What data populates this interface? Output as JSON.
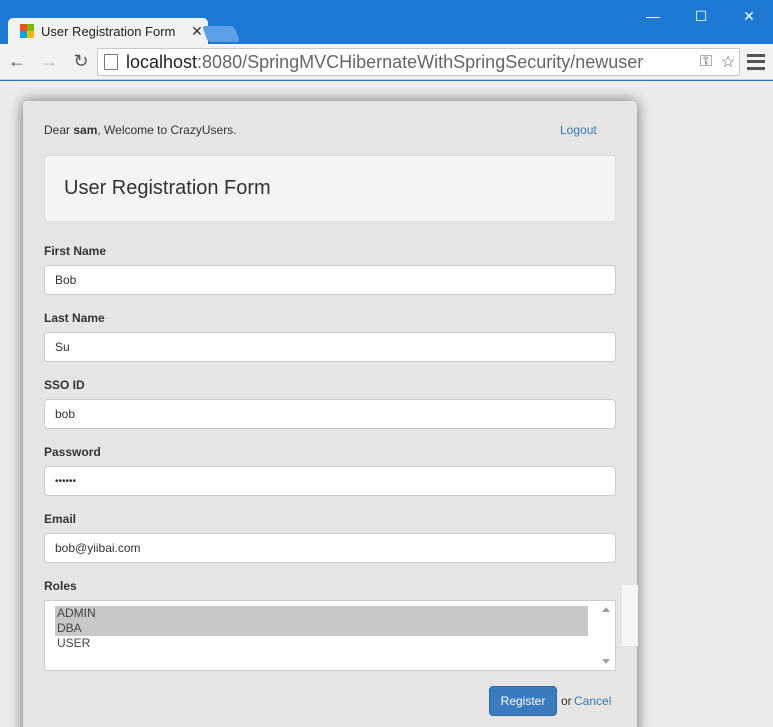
{
  "window": {
    "tab_title": "User Registration Form",
    "tab_close": "✕",
    "minimize": "—",
    "maximize": "☐",
    "close": "✕"
  },
  "toolbar": {
    "back": "←",
    "forward": "→",
    "reload": "↻",
    "url_host": "localhost",
    "url_rest": ":8080/SpringMVCHibernateWithSpringSecurity/newuser",
    "key_icon": "⚿",
    "star_icon": "☆"
  },
  "header": {
    "greeting_prefix": "Dear ",
    "username": "sam",
    "greeting_suffix": ", Welcome to CrazyUsers.",
    "logout": "Logout"
  },
  "form": {
    "title": "User Registration Form",
    "first_name": {
      "label": "First Name",
      "value": "Bob"
    },
    "last_name": {
      "label": "Last Name",
      "value": "Su"
    },
    "sso_id": {
      "label": "SSO ID",
      "value": "bob"
    },
    "password": {
      "label": "Password",
      "value": "••••••"
    },
    "email": {
      "label": "Email",
      "value": "bob@yiibai.com"
    },
    "roles": {
      "label": "Roles",
      "options": [
        {
          "label": "ADMIN",
          "selected": true
        },
        {
          "label": "DBA",
          "selected": true
        },
        {
          "label": "USER",
          "selected": false
        }
      ]
    },
    "register": "Register",
    "or": "or",
    "cancel": "Cancel"
  },
  "colors": {
    "titlebar": "#1c79d4",
    "primary_button": "#3a7bc0",
    "link": "#337ab7"
  }
}
